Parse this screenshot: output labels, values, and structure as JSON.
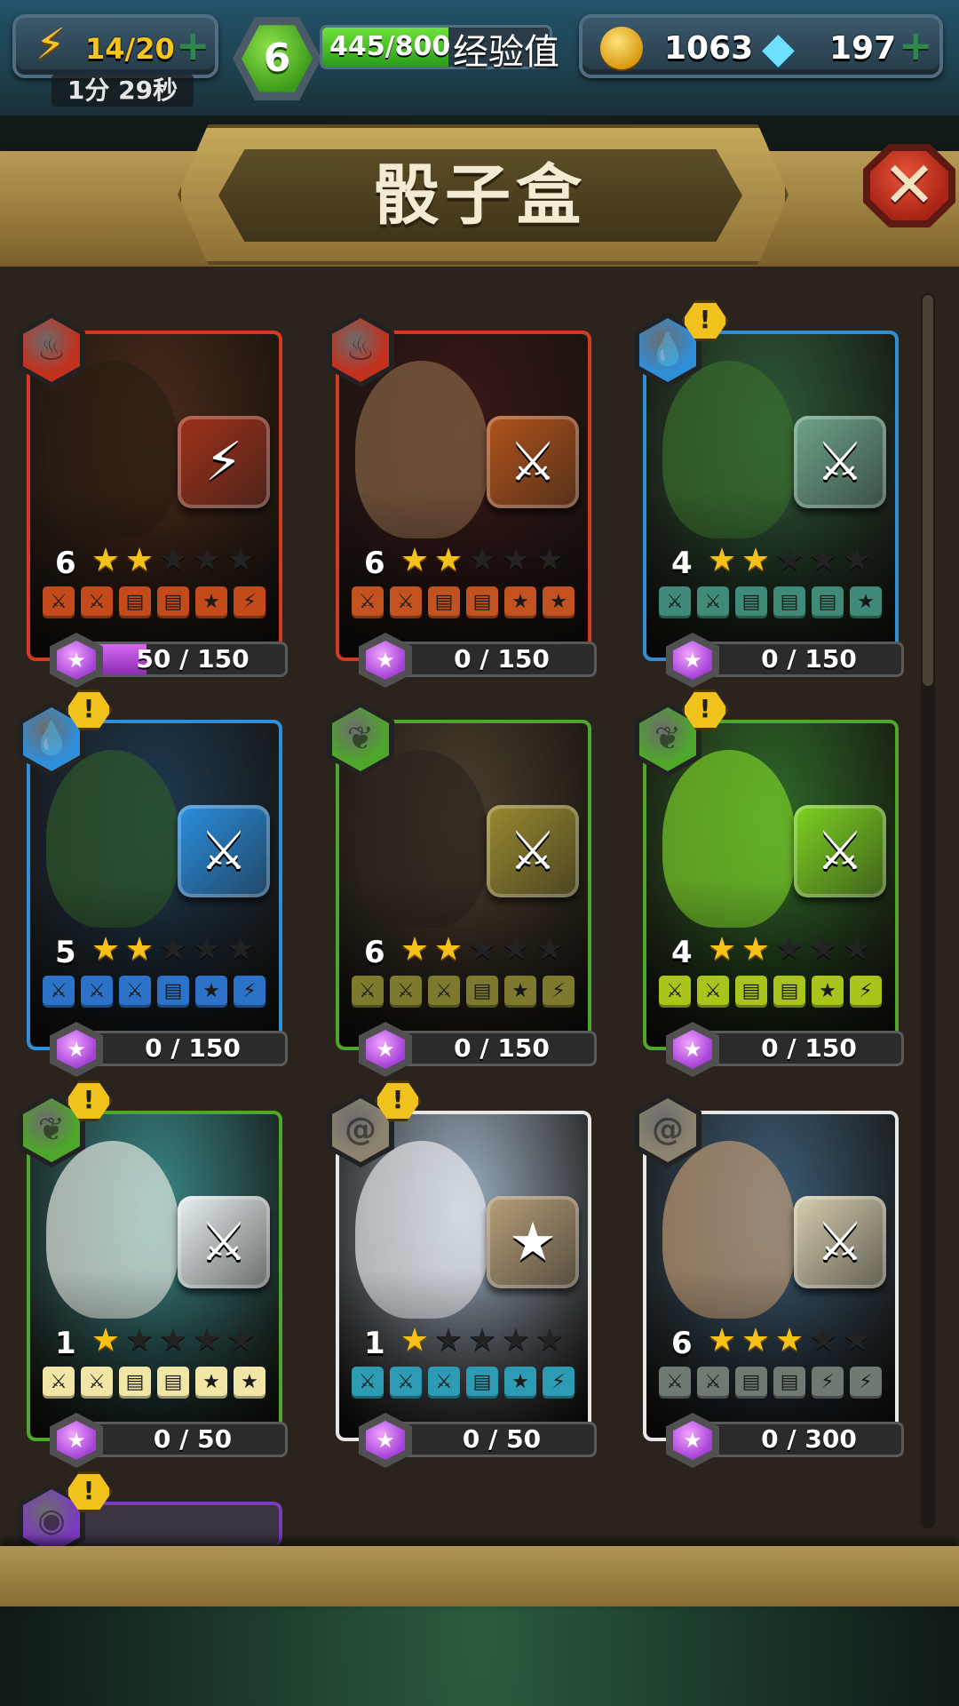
{
  "hud": {
    "energy": "14/20",
    "timer": "1分 29秒",
    "level": "6",
    "xp": "445/800",
    "xp_progress": 0.556,
    "xp_label": "经验值",
    "gold": "1063",
    "gems": "197"
  },
  "title": "骰子盒",
  "colors": {
    "fire": "#c2301e",
    "water": "#2f8ed8",
    "nature": "#4ea62a",
    "air": "#8c8470",
    "arcane": "#7a3bbf"
  },
  "cards": [
    {
      "element": "fire",
      "alert": false,
      "level": "6",
      "stars": 2,
      "progress": "50 / 150",
      "progress_value": 0.333,
      "faces": [
        "sword",
        "sword",
        "shield",
        "shield",
        "star",
        "bolt"
      ],
      "face_color": "#c24a1b",
      "die_color": "#a0321a",
      "die_symbol": "bolt",
      "art_color": "#4a2a1a",
      "border": "#d23a22",
      "creature_color": "#2a1d12"
    },
    {
      "element": "fire",
      "alert": false,
      "level": "6",
      "stars": 2,
      "progress": "0 / 150",
      "progress_value": 0,
      "faces": [
        "sword",
        "sword",
        "shield",
        "shield",
        "star",
        "star"
      ],
      "face_color": "#c2521f",
      "die_color": "#b3541b",
      "die_symbol": "sword",
      "art_color": "#3a1818",
      "border": "#d23a22",
      "creature_color": "#8c6a4a"
    },
    {
      "element": "water",
      "alert": true,
      "level": "4",
      "stars": 2,
      "progress": "0 / 150",
      "progress_value": 0,
      "faces": [
        "sword",
        "sword",
        "shield",
        "shield",
        "shield",
        "star"
      ],
      "face_color": "#3f8a78",
      "die_color": "#6fa58a",
      "die_symbol": "sword",
      "art_color": "#2d5a3a",
      "border": "#2f8ed8",
      "creature_color": "#3a6e2c"
    },
    {
      "element": "water",
      "alert": true,
      "level": "5",
      "stars": 2,
      "progress": "0 / 150",
      "progress_value": 0,
      "faces": [
        "sword",
        "sword",
        "sword",
        "shield",
        "star",
        "bolt"
      ],
      "face_color": "#2b72c8",
      "die_color": "#2b8fe0",
      "die_symbol": "sword",
      "art_color": "#1e3a52",
      "border": "#2f8ed8",
      "creature_color": "#2f5a2a"
    },
    {
      "element": "nature",
      "alert": false,
      "level": "6",
      "stars": 2,
      "progress": "0 / 150",
      "progress_value": 0,
      "faces": [
        "sword",
        "sword",
        "sword",
        "shield",
        "star",
        "bolt"
      ],
      "face_color": "#7d7a2e",
      "die_color": "#9a8a2f",
      "die_symbol": "sword",
      "art_color": "#4a3e2e",
      "border": "#4ea62a",
      "creature_color": "#2b241d"
    },
    {
      "element": "nature",
      "alert": true,
      "level": "4",
      "stars": 2,
      "progress": "0 / 150",
      "progress_value": 0,
      "faces": [
        "sword",
        "sword",
        "shield",
        "shield",
        "star",
        "bolt"
      ],
      "face_color": "#a9c51b",
      "die_color": "#7ed321",
      "die_symbol": "sword",
      "art_color": "#2f6a2a",
      "border": "#4ea62a",
      "creature_color": "#7fd52a"
    },
    {
      "element": "nature",
      "alert": true,
      "level": "1",
      "stars": 1,
      "progress": "0 / 50",
      "progress_value": 0,
      "faces": [
        "sword",
        "sword",
        "shield",
        "shield",
        "star",
        "star"
      ],
      "face_color": "#f2e6a6",
      "die_color": "#e9f1f2",
      "die_symbol": "sword",
      "art_color": "#3a8a8a",
      "border": "#4ea62a",
      "creature_color": "#f0efe8"
    },
    {
      "element": "air",
      "alert": true,
      "level": "1",
      "stars": 1,
      "progress": "0 / 50",
      "progress_value": 0,
      "faces": [
        "sword",
        "sword",
        "sword",
        "shield",
        "star",
        "bolt"
      ],
      "face_color": "#2c9bb3",
      "die_color": "#b8a07a",
      "die_symbol": "star",
      "art_color": "#9eb0c2",
      "border": "#e6e6e6",
      "creature_color": "#eef0f3"
    },
    {
      "element": "air",
      "alert": false,
      "level": "6",
      "stars": 3,
      "progress": "0 / 300",
      "progress_value": 0,
      "faces": [
        "sword",
        "sword",
        "shield",
        "shield",
        "bolt",
        "bolt"
      ],
      "face_color": "#6f7a72",
      "die_color": "#d8cfb0",
      "die_symbol": "sword",
      "art_color": "#3d5e78",
      "border": "#e6e6e6",
      "creature_color": "#c9a077"
    },
    {
      "element": "arcane",
      "alert": true,
      "partial": true
    }
  ]
}
